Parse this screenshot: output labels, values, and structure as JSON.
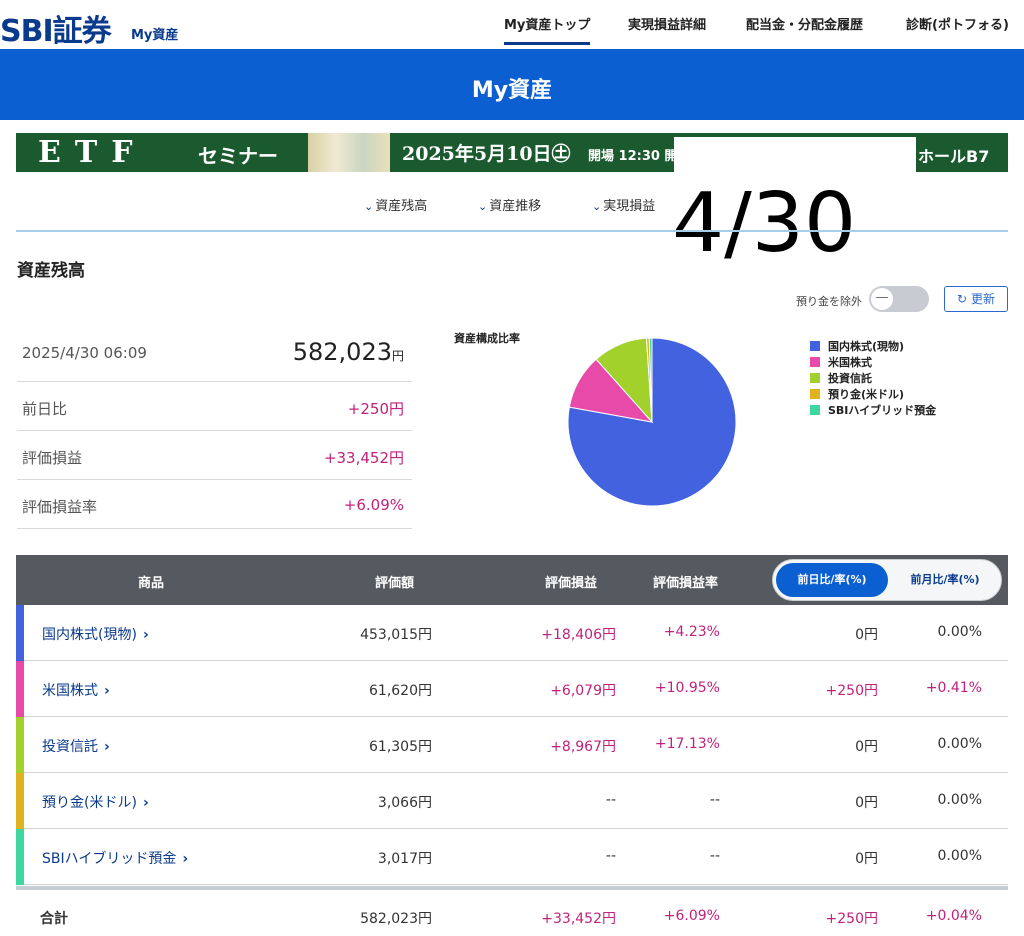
{
  "header": {
    "logo": "SBI証券",
    "logo_sub": "My資産",
    "nav": [
      {
        "label": "My資産トップ"
      },
      {
        "label": "実現損益詳細"
      },
      {
        "label": "配当金・分配金履歴"
      },
      {
        "label": "診断(ポトフォる)"
      }
    ]
  },
  "page_title": "My資産",
  "banner": {
    "etf": "ETF",
    "seminar": "セミナー",
    "date": "2025年5月10日㊏",
    "open": "開場 12:30 開",
    "hall": "ホールB7"
  },
  "overlay_date": "4/30",
  "anchors": [
    {
      "label": "資産残高"
    },
    {
      "label": "資産推移"
    },
    {
      "label": "実現損益"
    }
  ],
  "section_title": "資産残高",
  "controls": {
    "toggle_label": "預り金を除外",
    "toggle_knob": "—",
    "refresh_label": "更新",
    "refresh_icon": "↻"
  },
  "summary": {
    "timestamp": "2025/4/30 06:09",
    "total": "582,023",
    "total_unit": "円",
    "rows": [
      {
        "label": "前日比",
        "value": "+250円"
      },
      {
        "label": "評価損益",
        "value": "+33,452円"
      },
      {
        "label": "評価損益率",
        "value": "+6.09%"
      }
    ]
  },
  "chart_data": {
    "type": "pie",
    "title": "資産構成比率",
    "categories": [
      "国内株式(現物)",
      "米国株式",
      "投資信託",
      "預り金(米ドル)",
      "SBIハイブリッド預金"
    ],
    "values": [
      453015,
      61620,
      61305,
      3066,
      3017
    ],
    "colors": [
      "#4262e0",
      "#e84aaa",
      "#a3d12c",
      "#e0b21e",
      "#3ed7a0"
    ],
    "legend_position": "right"
  },
  "table": {
    "headers": {
      "product": "商品",
      "value": "評価額",
      "gain": "評価損益",
      "gain_rate": "評価損益率",
      "seg_active": "前日比/率(%)",
      "seg_inactive": "前月比/率(%)"
    },
    "rows": [
      {
        "name": "国内株式(現物)",
        "value": "453,015円",
        "gain": "+18,406円",
        "rate": "+4.23%",
        "day": "0円",
        "day_rate": "0.00%",
        "color": "#4262e0",
        "day_pink": false
      },
      {
        "name": "米国株式",
        "value": "61,620円",
        "gain": "+6,079円",
        "rate": "+10.95%",
        "day": "+250円",
        "day_rate": "+0.41%",
        "color": "#e84aaa",
        "day_pink": true
      },
      {
        "name": "投資信託",
        "value": "61,305円",
        "gain": "+8,967円",
        "rate": "+17.13%",
        "day": "0円",
        "day_rate": "0.00%",
        "color": "#a3d12c",
        "day_pink": false
      },
      {
        "name": "預り金(米ドル)",
        "value": "3,066円",
        "gain": "--",
        "rate": "--",
        "day": "0円",
        "day_rate": "0.00%",
        "color": "#e0b21e",
        "day_pink": false
      },
      {
        "name": "SBIハイブリッド預金",
        "value": "3,017円",
        "gain": "--",
        "rate": "--",
        "day": "0円",
        "day_rate": "0.00%",
        "color": "#3ed7a0",
        "day_pink": false
      }
    ],
    "total": {
      "name": "合計",
      "value": "582,023円",
      "gain": "+33,452円",
      "rate": "+6.09%",
      "day": "+250円",
      "day_rate": "+0.04%"
    }
  }
}
